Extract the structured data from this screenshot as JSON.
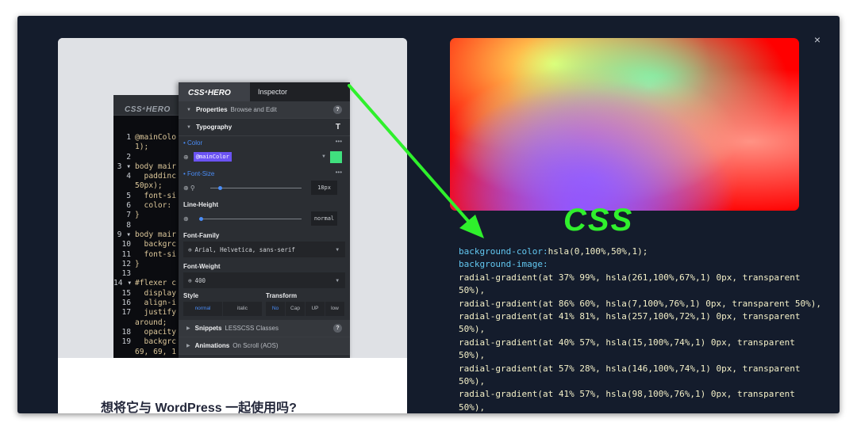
{
  "window": {
    "close_glyph": "×"
  },
  "left": {
    "caption": "想将它与 WordPress 一起使用吗?",
    "editor": {
      "brand": "CSS⁴HERO",
      "lines": [
        {
          "num": "1",
          "text": "@mainColo"
        },
        {
          "num": "",
          "text": "1);"
        },
        {
          "num": "2",
          "text": ""
        },
        {
          "num": "3 ▾",
          "text": "body mair"
        },
        {
          "num": "4",
          "text": "  paddinc"
        },
        {
          "num": "",
          "text": "50px);"
        },
        {
          "num": "5",
          "text": "  font-si"
        },
        {
          "num": "6",
          "text": "  color:"
        },
        {
          "num": "7",
          "text": "}"
        },
        {
          "num": "8",
          "text": ""
        },
        {
          "num": "9 ▾",
          "text": "body mair"
        },
        {
          "num": "10",
          "text": "  backgrc"
        },
        {
          "num": "11",
          "text": "  font-si"
        },
        {
          "num": "12",
          "text": "}"
        },
        {
          "num": "13",
          "text": ""
        },
        {
          "num": "14 ▾",
          "text": "#flexer c"
        },
        {
          "num": "15",
          "text": "  display"
        },
        {
          "num": "16",
          "text": "  align-i"
        },
        {
          "num": "17",
          "text": "  justify"
        },
        {
          "num": "",
          "text": "around;"
        },
        {
          "num": "18",
          "text": "  opacity"
        },
        {
          "num": "19",
          "text": "  backgrc"
        },
        {
          "num": "",
          "text": "69, 69, 1"
        }
      ]
    },
    "inspector": {
      "brand": "CSS⁴HERO",
      "tab": "Inspector",
      "properties": {
        "title": "Properties",
        "sub": "Browse and Edit"
      },
      "typography": "Typography",
      "typography_glyph": "T",
      "color_label": "Color",
      "color_value": "@mainColor",
      "font_size_label": "Font-Size",
      "font_size_value": "18px",
      "line_height_label": "Line-Height",
      "line_height_value": "normal",
      "font_family_label": "Font-Family",
      "font_family_value": "Arial, Helvetica, sans-serif",
      "font_weight_label": "Font-Weight",
      "font_weight_value": "400",
      "style_label": "Style",
      "transform_label": "Transform",
      "style_options": [
        "normal",
        "italic"
      ],
      "transform_options": [
        "No",
        "Cap",
        "UP",
        "low"
      ],
      "snippets": {
        "title": "Snippets",
        "sub": "LESSCSS Classes"
      },
      "animations": {
        "title": "Animations",
        "sub": "On Scroll (AOS)"
      },
      "more_glyph": "•••",
      "help_glyph": "?"
    }
  },
  "right": {
    "css_label": "CSS",
    "code_lines": [
      [
        {
          "c": "k",
          "t": "background-color:"
        },
        {
          "c": "s",
          "t": "hsla(0,100%,50%,1);"
        }
      ],
      [
        {
          "c": "k",
          "t": "background-image:"
        }
      ],
      [
        {
          "c": "s",
          "t": "radial-gradient(at 37% 99%, hsla(261,100%,67%,1) 0px, transparent"
        }
      ],
      [
        {
          "c": "s",
          "t": "50%),"
        }
      ],
      [
        {
          "c": "s",
          "t": "radial-gradient(at 86% 60%, hsla(7,100%,76%,1) 0px, transparent 50%),"
        }
      ],
      [
        {
          "c": "s",
          "t": "radial-gradient(at 41% 81%, hsla(257,100%,72%,1) 0px, transparent"
        }
      ],
      [
        {
          "c": "s",
          "t": "50%),"
        }
      ],
      [
        {
          "c": "s",
          "t": "radial-gradient(at 40% 57%, hsla(15,100%,74%,1) 0px, transparent"
        }
      ],
      [
        {
          "c": "s",
          "t": "50%),"
        }
      ],
      [
        {
          "c": "s",
          "t": "radial-gradient(at 57% 28%, hsla(146,100%,74%,1) 0px, transparent"
        }
      ],
      [
        {
          "c": "s",
          "t": "50%),"
        }
      ],
      [
        {
          "c": "s",
          "t": "radial-gradient(at 41% 57%, hsla(98,100%,76%,1) 0px, transparent"
        }
      ],
      [
        {
          "c": "s",
          "t": "50%),"
        }
      ]
    ]
  },
  "colors": {
    "frame": "#141c2c",
    "accent_green": "#30f02d",
    "keyword_blue": "#62c7f0",
    "swatch": "#40e07e"
  }
}
